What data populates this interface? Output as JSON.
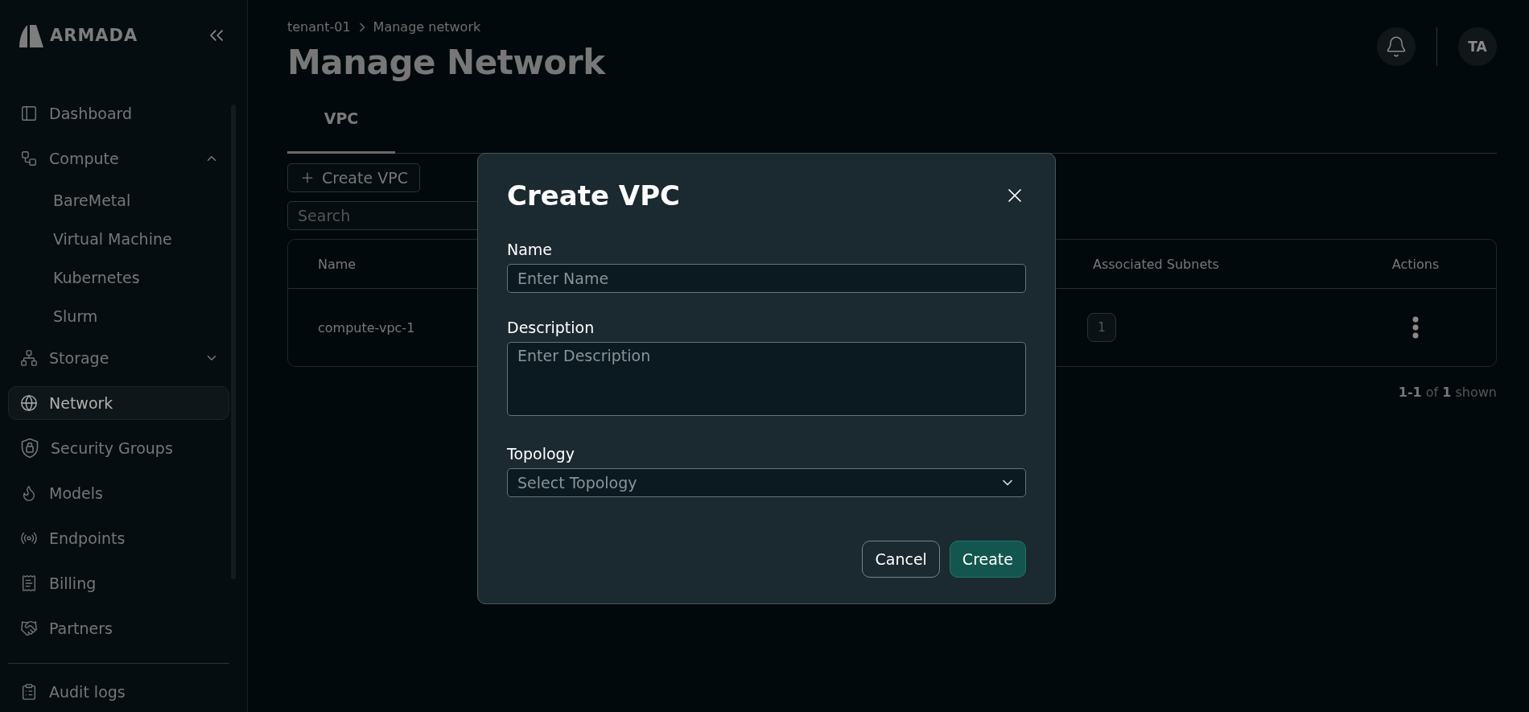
{
  "sidebar": {
    "logo": "ARMADA",
    "items": [
      {
        "label": "Dashboard",
        "selected": false
      },
      {
        "label": "Compute",
        "selected": false,
        "expanded": true,
        "children": [
          {
            "label": "BareMetal",
            "selected": false
          },
          {
            "label": "Virtual Machine",
            "selected": false
          },
          {
            "label": "Kubernetes",
            "selected": false
          },
          {
            "label": "Slurm",
            "selected": false
          }
        ]
      },
      {
        "label": "Storage",
        "selected": false,
        "expanded": false
      },
      {
        "label": "Network",
        "selected": true
      },
      {
        "label": "Security Groups",
        "selected": false
      },
      {
        "label": "Models",
        "selected": false
      },
      {
        "label": "Endpoints",
        "selected": false
      },
      {
        "label": "Billing",
        "selected": false
      },
      {
        "label": "Partners",
        "selected": false
      }
    ],
    "bottom_items": [
      {
        "label": "Audit logs",
        "selected": false
      }
    ]
  },
  "header": {
    "breadcrumb": [
      "tenant-01",
      "Manage network"
    ],
    "title": "Manage Network",
    "avatar": "TA"
  },
  "tabs": [
    {
      "label": "VPC",
      "selected": true
    }
  ],
  "toolbar": {
    "create_button": "Create VPC",
    "search": {
      "placeholder": "Search"
    }
  },
  "table": {
    "columns": [
      "Name",
      "Associated Subnets",
      "Actions"
    ],
    "rows": [
      {
        "name": "compute-vpc-1",
        "associated_subnets": "1"
      }
    ]
  },
  "pagination": {
    "range": "1-1",
    "of": "of",
    "total": "1",
    "suffix": "shown"
  },
  "dialog": {
    "title": "Create VPC",
    "fields": [
      {
        "kind": "input",
        "label": "Name",
        "placeholder": "Enter Name"
      },
      {
        "kind": "textarea",
        "label": "Description",
        "placeholder": "Enter Description"
      },
      {
        "kind": "select",
        "label": "Topology",
        "placeholder": "Select Topology"
      }
    ],
    "buttons": [
      {
        "kind": "secondary",
        "label": "Cancel"
      },
      {
        "kind": "primary",
        "label": "Create"
      }
    ]
  }
}
